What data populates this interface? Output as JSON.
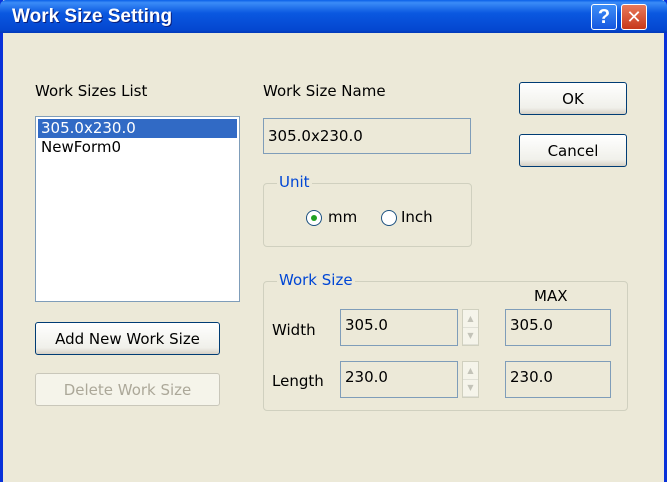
{
  "window": {
    "title": "Work Size Setting",
    "help_glyph": "?",
    "close_glyph": "✕"
  },
  "list": {
    "label": "Work Sizes List",
    "items": [
      {
        "label": "305.0x230.0",
        "selected": true
      },
      {
        "label": "NewForm0",
        "selected": false
      }
    ]
  },
  "name": {
    "label": "Work Size Name",
    "value": "305.0x230.0"
  },
  "buttons": {
    "ok": "OK",
    "cancel": "Cancel",
    "add": "Add New Work Size",
    "delete": "Delete Work Size"
  },
  "unit": {
    "group_label": "Unit",
    "mm": "mm",
    "inch": "Inch",
    "selected": "mm"
  },
  "size": {
    "group_label": "Work Size",
    "max_label": "MAX",
    "width_label": "Width",
    "width_value": "305.0",
    "width_max": "305.0",
    "length_label": "Length",
    "length_value": "230.0",
    "length_max": "230.0"
  },
  "colors": {
    "title_bar": "#0a58e0",
    "selection": "#316ac5",
    "group_title": "#0046d5",
    "radio_dot": "#21a121"
  }
}
